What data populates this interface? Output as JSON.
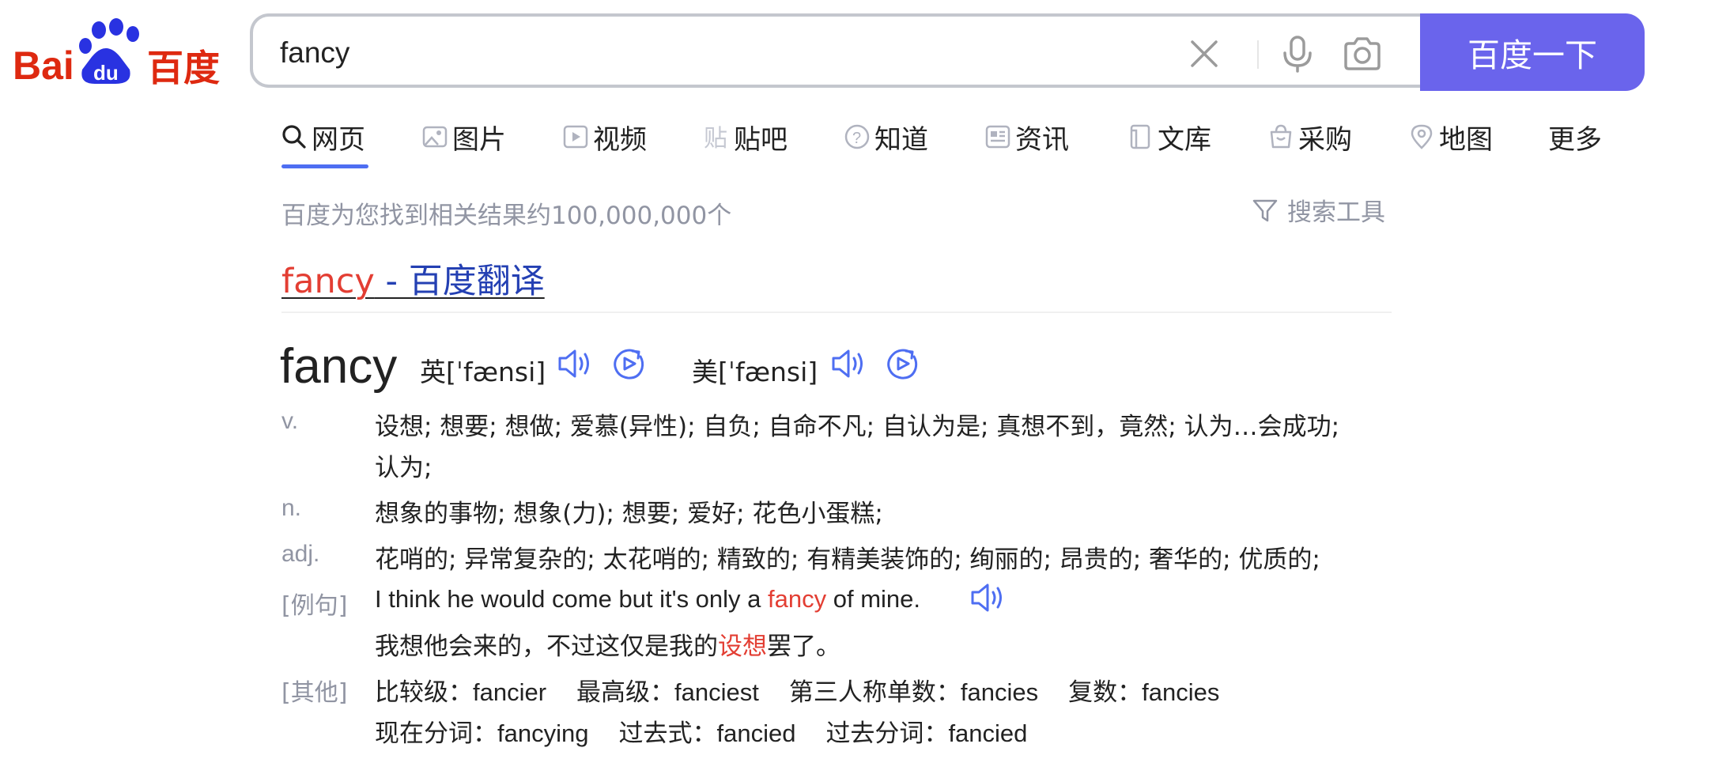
{
  "search": {
    "query": "fancy",
    "button_label": "百度一下"
  },
  "tabs": [
    {
      "label": "网页",
      "icon": "search-icon",
      "active": true
    },
    {
      "label": "图片",
      "icon": "image-icon"
    },
    {
      "label": "视频",
      "icon": "video-icon"
    },
    {
      "label": "贴吧",
      "icon": "tieba-icon"
    },
    {
      "label": "知道",
      "icon": "question-icon"
    },
    {
      "label": "资讯",
      "icon": "news-icon"
    },
    {
      "label": "文库",
      "icon": "document-icon"
    },
    {
      "label": "采购",
      "icon": "shopping-icon"
    },
    {
      "label": "地图",
      "icon": "map-icon"
    },
    {
      "label": "更多"
    }
  ],
  "results_info": {
    "count_text": "百度为您找到相关结果约100,000,000个",
    "tools_label": "搜索工具"
  },
  "result": {
    "title_highlight": "fancy",
    "title_rest": " - 百度翻译",
    "word": "fancy",
    "uk_phonetic": "英[ˈfænsi]",
    "us_phonetic": "美[ˈfænsi]",
    "definitions": [
      {
        "pos": "v.",
        "lines": [
          "设想; 想要; 想做; 爱慕(异性); 自负; 自命不凡; 自认为是; 真想不到，竟然; 认为…会成功;",
          "认为;"
        ]
      },
      {
        "pos": "n.",
        "lines": [
          "想象的事物; 想象(力); 想要; 爱好; 花色小蛋糕;"
        ]
      },
      {
        "pos": "adj.",
        "lines": [
          "花哨的; 异常复杂的; 太花哨的; 精致的; 有精美装饰的; 绚丽的; 昂贵的; 奢华的; 优质的;"
        ]
      }
    ],
    "example": {
      "label": "[例句]",
      "en_before": "I think he would come but it's only a ",
      "en_highlight": "fancy",
      "en_after": " of mine.",
      "zh_before": "我想他会来的，不过这仅是我的",
      "zh_highlight": "设想",
      "zh_after": "罢了。"
    },
    "other": {
      "label": "[其他]",
      "forms": [
        {
          "label": "比较级：",
          "value": "fancier"
        },
        {
          "label": "最高级：",
          "value": "fanciest"
        },
        {
          "label": "第三人称单数：",
          "value": "fancies"
        },
        {
          "label": "复数：",
          "value": "fancies"
        },
        {
          "label": "现在分词：",
          "value": "fancying"
        },
        {
          "label": "过去式：",
          "value": "fancied"
        },
        {
          "label": "过去分词：",
          "value": "fancied"
        }
      ]
    }
  },
  "colors": {
    "accent": "#4e6ef2",
    "button": "#6a64ec",
    "highlight": "#e33e33",
    "link": "#2440b3",
    "muted": "#9195a3"
  }
}
